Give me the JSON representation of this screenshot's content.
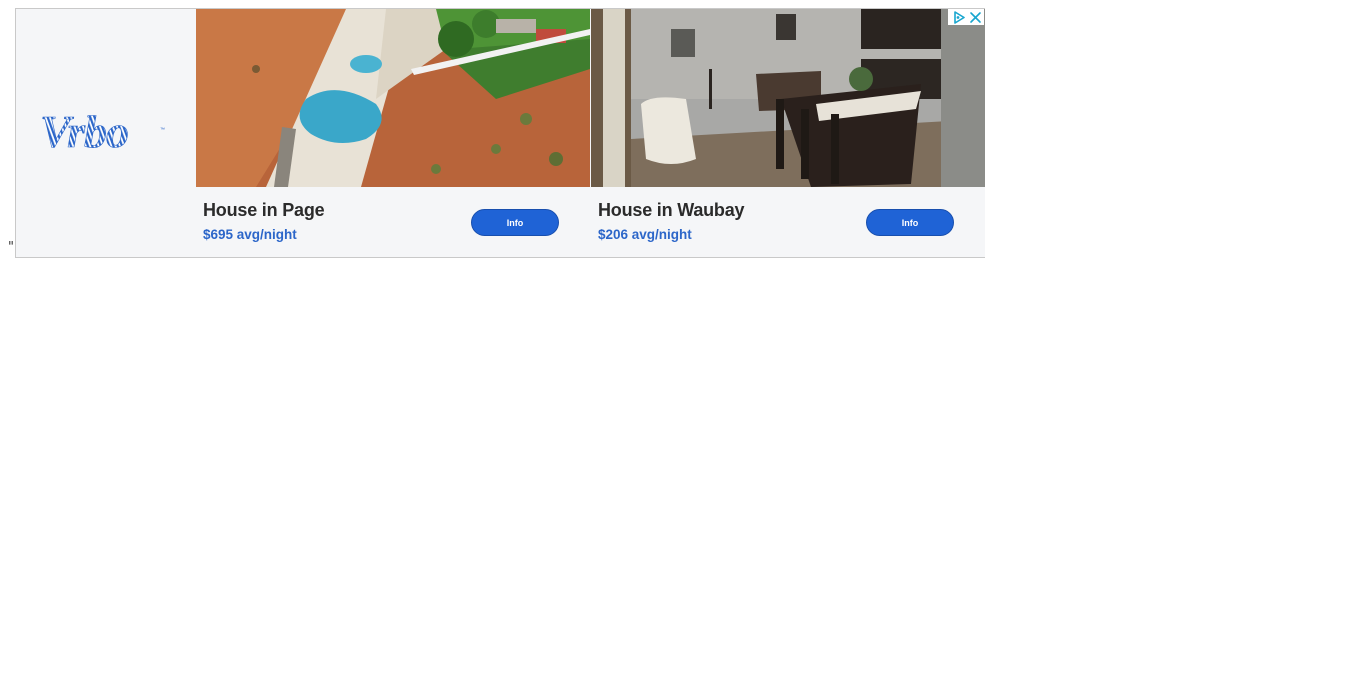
{
  "page": {
    "stray_text": "\""
  },
  "ad": {
    "brand": "Vrbo",
    "brand_color": "#2c66c9",
    "adchoices_icon": "adchoices-triangle-icon",
    "close_icon": "close-icon",
    "listings": [
      {
        "title": "House in Page",
        "price": "$695 avg/night",
        "button": "Info"
      },
      {
        "title": "House in Waubay",
        "price": "$206 avg/night",
        "button": "Info"
      }
    ]
  }
}
